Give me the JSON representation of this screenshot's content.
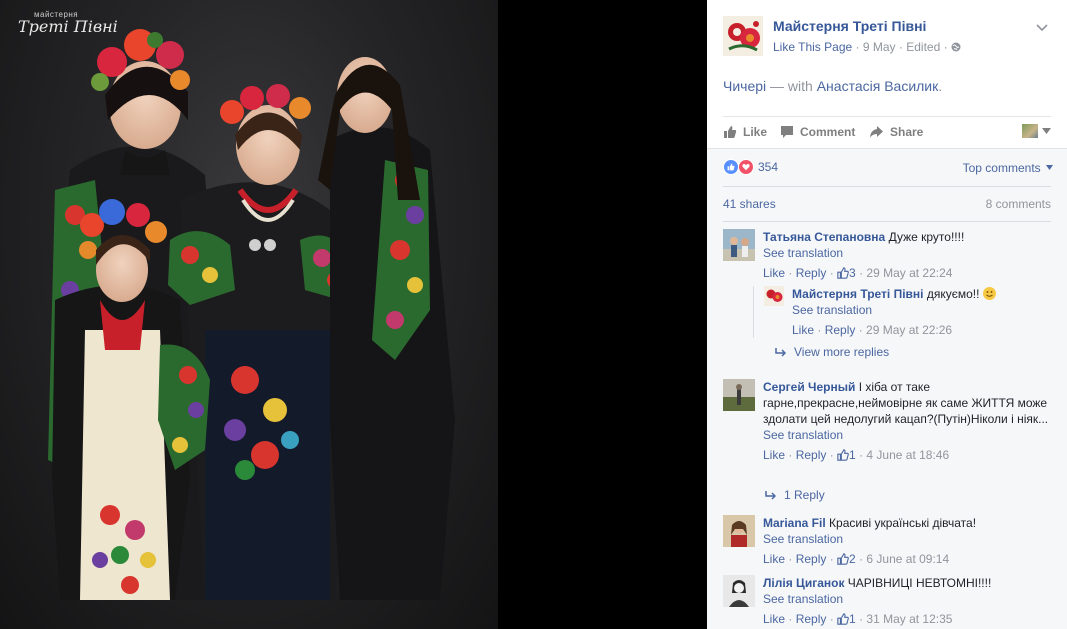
{
  "photo": {
    "watermark_top": "майстерня",
    "watermark_main": "Треті Півні"
  },
  "post": {
    "page_name": "Майстерня Треті Півні",
    "like_page": "Like This Page",
    "date": "9 May",
    "edited": "Edited",
    "caption_main": "Чичері",
    "caption_with": " — with ",
    "caption_person": "Анастасія Василик",
    "caption_end": "."
  },
  "actions": {
    "like": "Like",
    "comment": "Comment",
    "share": "Share"
  },
  "feedback": {
    "reaction_count": "354",
    "top_comments": "Top comments",
    "shares": "41 shares",
    "comment_count": "8 comments"
  },
  "comments": [
    {
      "author": "Татьяна Степановна",
      "text": "Дуже круто!!!!",
      "see_translation": "See translation",
      "like": "Like",
      "reply": "Reply",
      "likes": "3",
      "time": "29 May at 22:24",
      "reply_item": {
        "author": "Майстерня Треті Півні",
        "text": "дякуємо!!",
        "see_translation": "See translation",
        "like": "Like",
        "reply": "Reply",
        "time": "29 May at 22:26"
      },
      "more_replies": "View more replies"
    },
    {
      "author": "Сергей Черный",
      "text": "І хіба от таке гарне,прекрасне,неймовірне як саме ЖИТТЯ може здолати цей недолугий кацап?(Путін)Ніколи і ніяк...",
      "see_translation": "See translation",
      "like": "Like",
      "reply": "Reply",
      "likes": "1",
      "time": "4 June at 18:46",
      "more_replies": "1 Reply"
    },
    {
      "author": "Mariana Fil",
      "text": "Красиві українські дівчата!",
      "see_translation": "See translation",
      "like": "Like",
      "reply": "Reply",
      "likes": "2",
      "time": "6 June at 09:14"
    },
    {
      "author": "Лілія Циганок",
      "text": "ЧАРІВНИЦІ НЕВТОМНІ!!!!",
      "see_translation": "See translation",
      "like": "Like",
      "reply": "Reply",
      "likes": "1",
      "time": "31 May at 12:35"
    }
  ],
  "icons": {
    "options": "chevron-down-icon",
    "globe": "globe-icon",
    "like": "thumbs-up-icon",
    "comment": "speech-bubble-icon",
    "share": "share-arrow-icon",
    "reply": "reply-arrow-icon"
  },
  "colors": {
    "link": "#365899",
    "muted": "#90949c",
    "action": "#7f7f7f",
    "like_reaction": "#5890ff",
    "love_reaction": "#f25268"
  }
}
